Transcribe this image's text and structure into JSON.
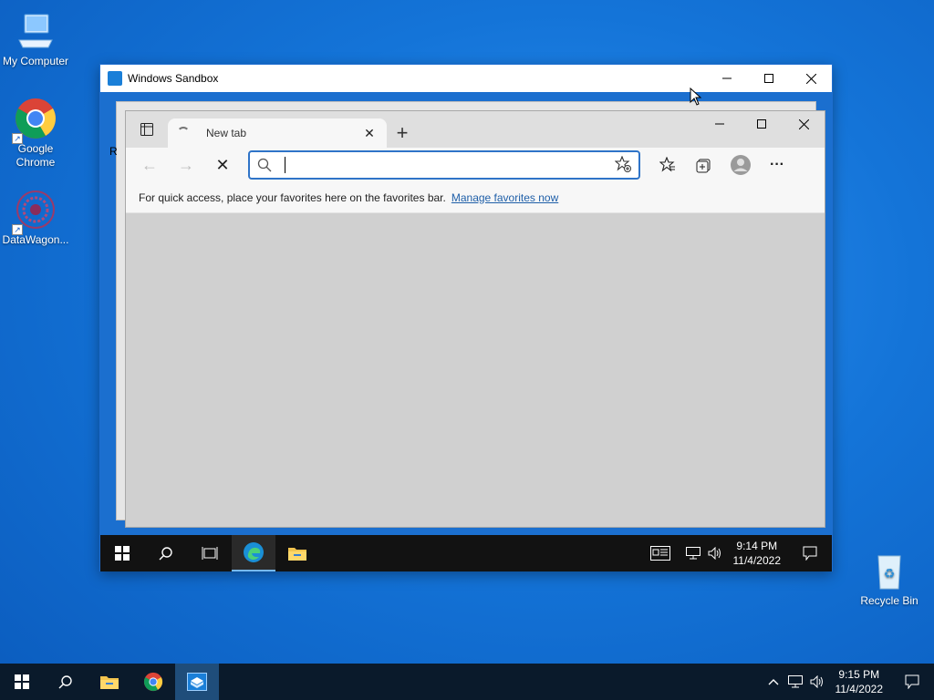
{
  "desktop": {
    "icons": [
      {
        "label": "My Computer"
      },
      {
        "label": "Google Chrome"
      },
      {
        "label": "DataWagon..."
      },
      {
        "label": "Recycle Bin"
      }
    ],
    "partial_letter": "R"
  },
  "sandbox_window": {
    "title": "Windows Sandbox",
    "minimize": "—",
    "maximize": "☐",
    "close": "✕"
  },
  "edge": {
    "tab_title": "New tab",
    "tab_close": "✕",
    "new_tab": "+",
    "back": "←",
    "forward": "→",
    "stop": "✕",
    "address_value": "",
    "favorites_message": "For quick access, place your favorites here on the favorites bar.",
    "favorites_link": "Manage favorites now",
    "more": "···"
  },
  "inner_taskbar": {
    "time": "9:14 PM",
    "date": "11/4/2022"
  },
  "taskbar": {
    "time": "9:15 PM",
    "date": "11/4/2022"
  },
  "colors": {
    "accent": "#2f74c8",
    "desktop": "#1474d8",
    "taskbar": "#0a1a2b"
  }
}
